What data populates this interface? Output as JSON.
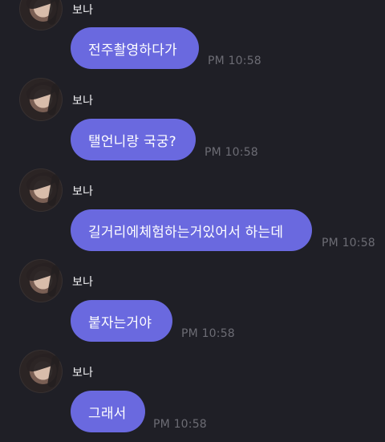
{
  "messages": [
    {
      "sender": "보나",
      "text": "전주촬영하다가",
      "time": "PM 10:58"
    },
    {
      "sender": "보나",
      "text": "탤언니랑 국궁?",
      "time": "PM 10:58"
    },
    {
      "sender": "보나",
      "text": "길거리에체험하는거있어서 하는데",
      "time": "PM 10:58"
    },
    {
      "sender": "보나",
      "text": "붙자는거야",
      "time": "PM 10:58"
    },
    {
      "sender": "보나",
      "text": "그래서",
      "time": "PM 10:58"
    }
  ]
}
